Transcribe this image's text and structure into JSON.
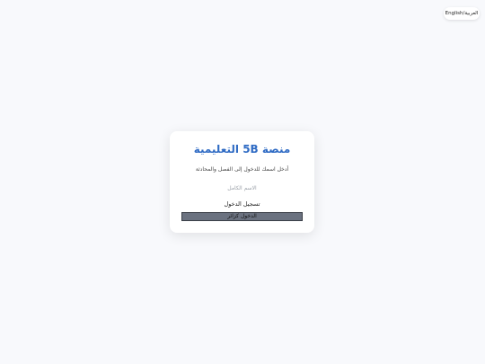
{
  "language_toggle": {
    "label": "English/العربية"
  },
  "login_card": {
    "title": "منصة 5B التعليمية",
    "subtitle": "أدخل اسمك للدخول إلى الفصل والمحادثة",
    "name_input": {
      "placeholder": "الاسم الكامل",
      "value": ""
    },
    "login_button": "تسجيل الدخول",
    "guest_button": "الدخول كزائر"
  },
  "colors": {
    "accent": "#2f6bc4",
    "background": "#f8f9fc",
    "guest_button_bg": "#6b7280"
  }
}
